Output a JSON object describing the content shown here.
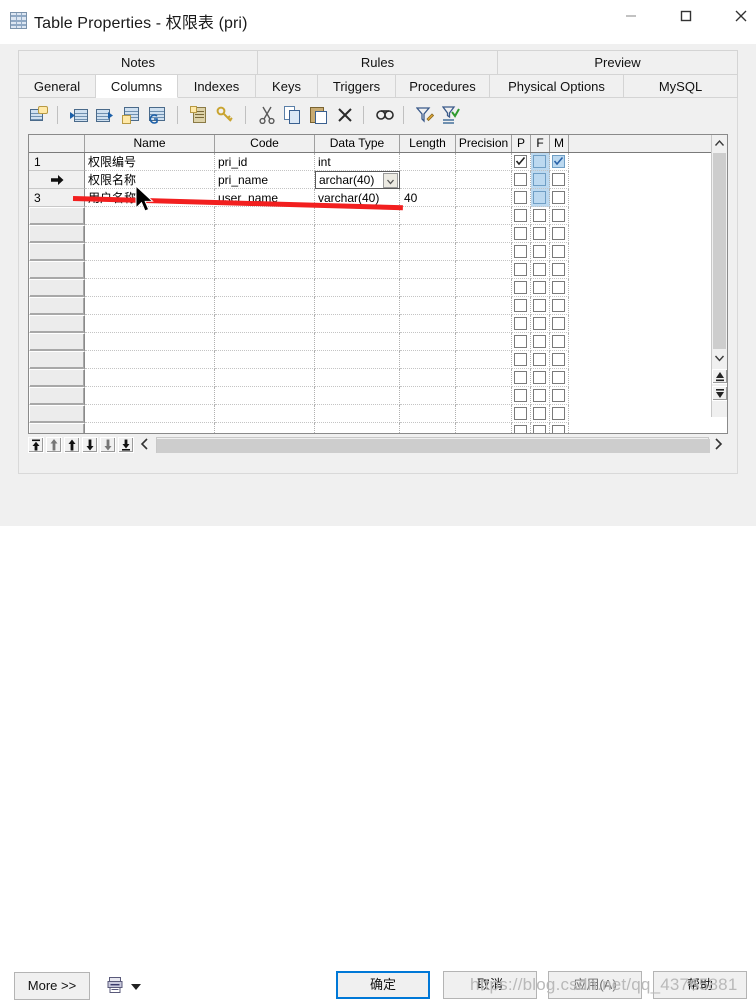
{
  "window": {
    "title": "Table Properties - 权限表 (pri)",
    "icon": "table-icon",
    "controls": {
      "minimize": "minimize-icon",
      "maximize": "maximize-icon",
      "close": "close-icon"
    }
  },
  "tabs": {
    "top_row": [
      {
        "label": "Notes",
        "active": false
      },
      {
        "label": "Rules",
        "active": false
      },
      {
        "label": "Preview",
        "active": false
      }
    ],
    "bottom_row": [
      {
        "label": "General",
        "active": false
      },
      {
        "label": "Columns",
        "active": true
      },
      {
        "label": "Indexes",
        "active": false
      },
      {
        "label": "Keys",
        "active": false
      },
      {
        "label": "Triggers",
        "active": false
      },
      {
        "label": "Procedures",
        "active": false
      },
      {
        "label": "Physical Options",
        "active": false
      },
      {
        "label": "MySQL",
        "active": false
      }
    ]
  },
  "toolbar": {
    "buttons": [
      {
        "name": "properties-icon"
      },
      {
        "name": "insert-row-icon"
      },
      {
        "name": "add-row-icon"
      },
      {
        "name": "add-table-icon"
      },
      {
        "name": "replace-table-icon"
      },
      {
        "name": "notes-icon"
      },
      {
        "name": "key-icon"
      },
      {
        "name": "cut-icon"
      },
      {
        "name": "copy-icon"
      },
      {
        "name": "paste-icon"
      },
      {
        "name": "delete-icon"
      },
      {
        "name": "find-icon"
      },
      {
        "name": "filter-edit-icon"
      },
      {
        "name": "filter-apply-icon"
      }
    ]
  },
  "grid": {
    "columns": [
      {
        "key": "rowhdr",
        "label": ""
      },
      {
        "key": "name",
        "label": "Name"
      },
      {
        "key": "code",
        "label": "Code"
      },
      {
        "key": "datatype",
        "label": "Data Type"
      },
      {
        "key": "length",
        "label": "Length"
      },
      {
        "key": "precision",
        "label": "Precision"
      },
      {
        "key": "p",
        "label": "P"
      },
      {
        "key": "f",
        "label": "F"
      },
      {
        "key": "m",
        "label": "M"
      }
    ],
    "rows": [
      {
        "num": "1",
        "indicator": "",
        "name": "权限编号",
        "code": "pri_id",
        "datatype": "int",
        "length": "",
        "precision": "",
        "p": true,
        "f": false,
        "m": true,
        "editing": false
      },
      {
        "num": "",
        "indicator": "current-row-arrow",
        "name": "权限名称",
        "code": "pri_name",
        "datatype": "archar(40)",
        "length": "",
        "precision": "",
        "p": false,
        "f": false,
        "m": false,
        "editing": true
      },
      {
        "num": "3",
        "indicator": "",
        "name": "用户名称",
        "code": "user_name",
        "datatype": "varchar(40)",
        "length": "40",
        "precision": "",
        "p": false,
        "f": false,
        "m": false,
        "editing": false
      }
    ],
    "empty_row_count": 15,
    "selected_column": "f",
    "vertical_scrollbar": {
      "up": "chevron-up-icon",
      "down": "chevron-down-icon"
    },
    "extra_buttons": [
      "scroll-to-top-icon",
      "scroll-to-bottom-icon"
    ],
    "nav_buttons": [
      "move-first-icon",
      "move-up-many-icon",
      "move-up-icon",
      "move-down-icon",
      "move-down-many-icon",
      "move-last-icon"
    ],
    "scroll_left": "chevron-left-icon",
    "scroll_right": "chevron-right-icon"
  },
  "footer": {
    "more_label": "More >>",
    "print_icon": "print-report-icon",
    "print_dropdown": "chevron-down-icon",
    "ok_label": "确定",
    "cancel_label": "取消",
    "apply_label": "应用(A)",
    "help_label": "帮助"
  },
  "annotations": {
    "red_line": "red-underline-annotation",
    "cursor": "mouse-pointer",
    "watermark": "https://blog.csdn.net/qq_43765881"
  },
  "colors": {
    "accent": "#0078d7",
    "annotation_red": "#f21f1f",
    "selected_cell": "#bcd9f0",
    "panel_bg": "#f0f0f0"
  }
}
